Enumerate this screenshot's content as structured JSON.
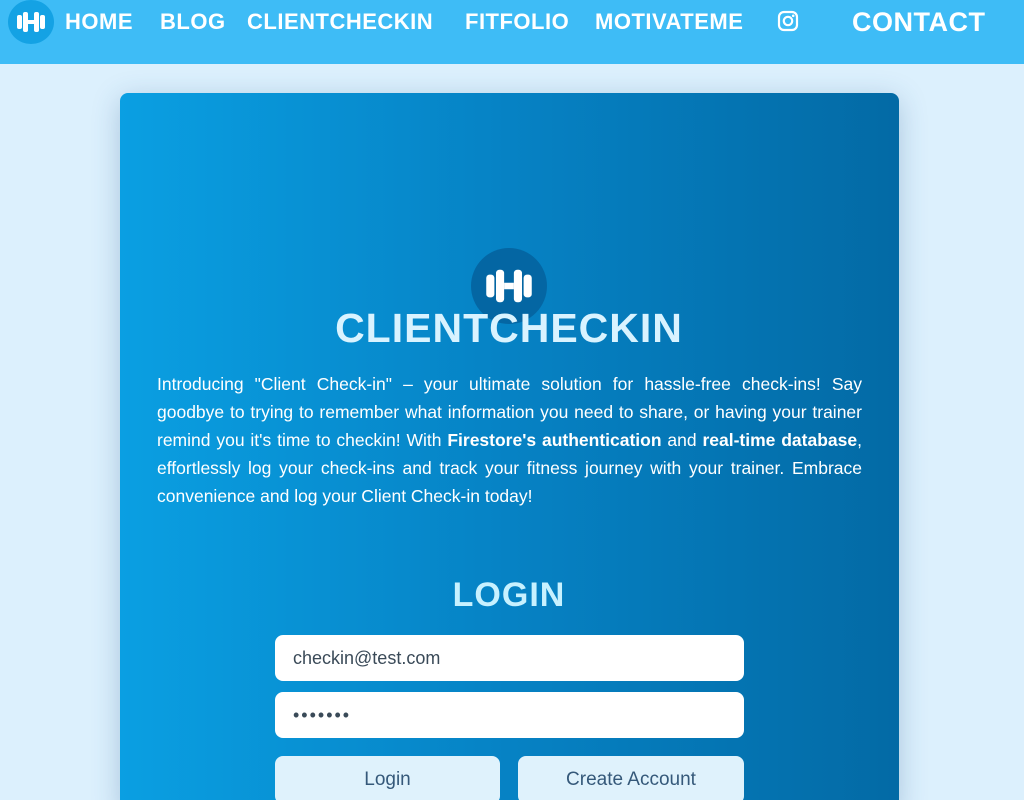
{
  "nav": {
    "logo_icon": "dumbbell-icon",
    "links": [
      "HOME",
      "BLOG",
      "CLIENTCHECKIN",
      "FITFOLIO",
      "MOTIVATEME"
    ],
    "instagram_icon": "instagram-icon",
    "contact": "CONTACT"
  },
  "hero": {
    "logo_icon": "dumbbell-icon",
    "title": "CLIENTCHECKIN",
    "intro_1": "Introducing \"Client Check-in\" – your ultimate solution for hassle-free check-ins! Say goodbye to trying to remember what information you need to share, or having your trainer remind you it's time to checkin! With ",
    "intro_bold_1": "Firestore's authentication",
    "intro_2": " and ",
    "intro_bold_2": "real-time database",
    "intro_3": ", effortlessly log your check-ins and track your fitness journey with your trainer. Embrace convenience and log your Client Check-in today!"
  },
  "login": {
    "title": "LOGIN",
    "email_value": "checkin@test.com",
    "password_value": "•••••••",
    "login_label": "Login",
    "create_label": "Create Account"
  },
  "colors": {
    "nav_bg": "#3ebcf6",
    "page_bg": "#dcf0fd",
    "card_gradient_start": "#0a9fe2",
    "card_gradient_end": "#036aa5",
    "button_bg": "#dff2fc"
  }
}
